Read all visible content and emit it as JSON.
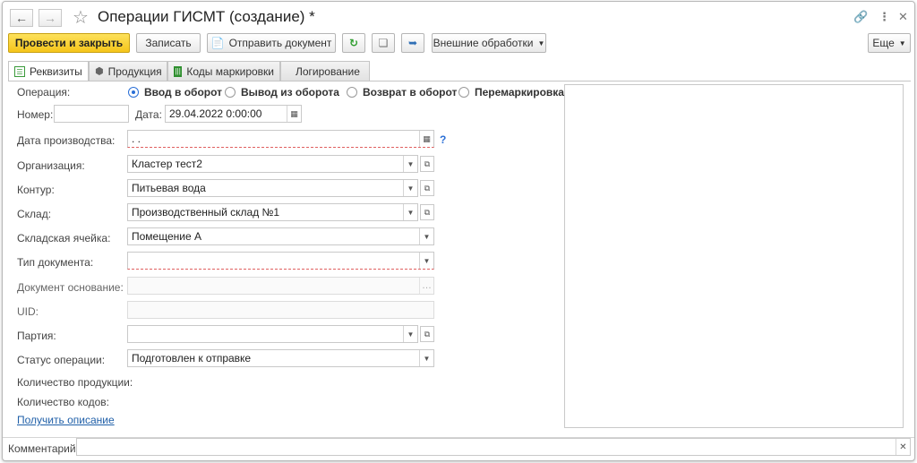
{
  "window": {
    "title": "Операции ГИСМТ (создание) *"
  },
  "toolbar": {
    "post_close": "Провести и закрыть",
    "save": "Записать",
    "send_doc": "Отправить документ",
    "ext_processing": "Внешние обработки",
    "more": "Еще"
  },
  "tabs": [
    {
      "label": "Реквизиты",
      "icon": "requisites-icon"
    },
    {
      "label": "Продукция",
      "icon": "box-icon"
    },
    {
      "label": "Коды маркировки",
      "icon": "barcode-icon"
    },
    {
      "label": "Логирование",
      "icon": ""
    }
  ],
  "form": {
    "operation_label": "Операция:",
    "operations": [
      "Ввод в оборот",
      "Вывод из оборота",
      "Возврат в оборот",
      "Перемаркировка"
    ],
    "selected_operation": "Ввод в оборот",
    "number_label": "Номер:",
    "number_value": "",
    "date_label": "Дата:",
    "date_value": "29.04.2022  0:00:00",
    "prod_date_label": "Дата производства:",
    "prod_date_value": " .  .",
    "help_mark": "?",
    "org_label": "Организация:",
    "org_value": "Кластер тест2",
    "contour_label": "Контур:",
    "contour_value": "Питьевая вода",
    "warehouse_label": "Склад:",
    "warehouse_value": "Производственный склад №1",
    "cell_label": "Складская ячейка:",
    "cell_value": "Помещение А",
    "doctype_label": "Тип документа:",
    "doctype_value": "",
    "basedoc_label": "Документ основание:",
    "basedoc_value": "",
    "uid_label": "UID:",
    "uid_value": "",
    "batch_label": "Партия:",
    "batch_value": "",
    "status_label": "Статус операции:",
    "status_value": "Подготовлен к отправке",
    "qty_products_label": "Количество продукции:",
    "qty_codes_label": "Количество кодов:",
    "get_description_link": "Получить описание",
    "comment_label": "Комментарий:",
    "comment_value": ""
  },
  "colors": {
    "primary": "#f5c51a",
    "link": "#1f5fa8",
    "radio_active": "#2a6fd6"
  }
}
